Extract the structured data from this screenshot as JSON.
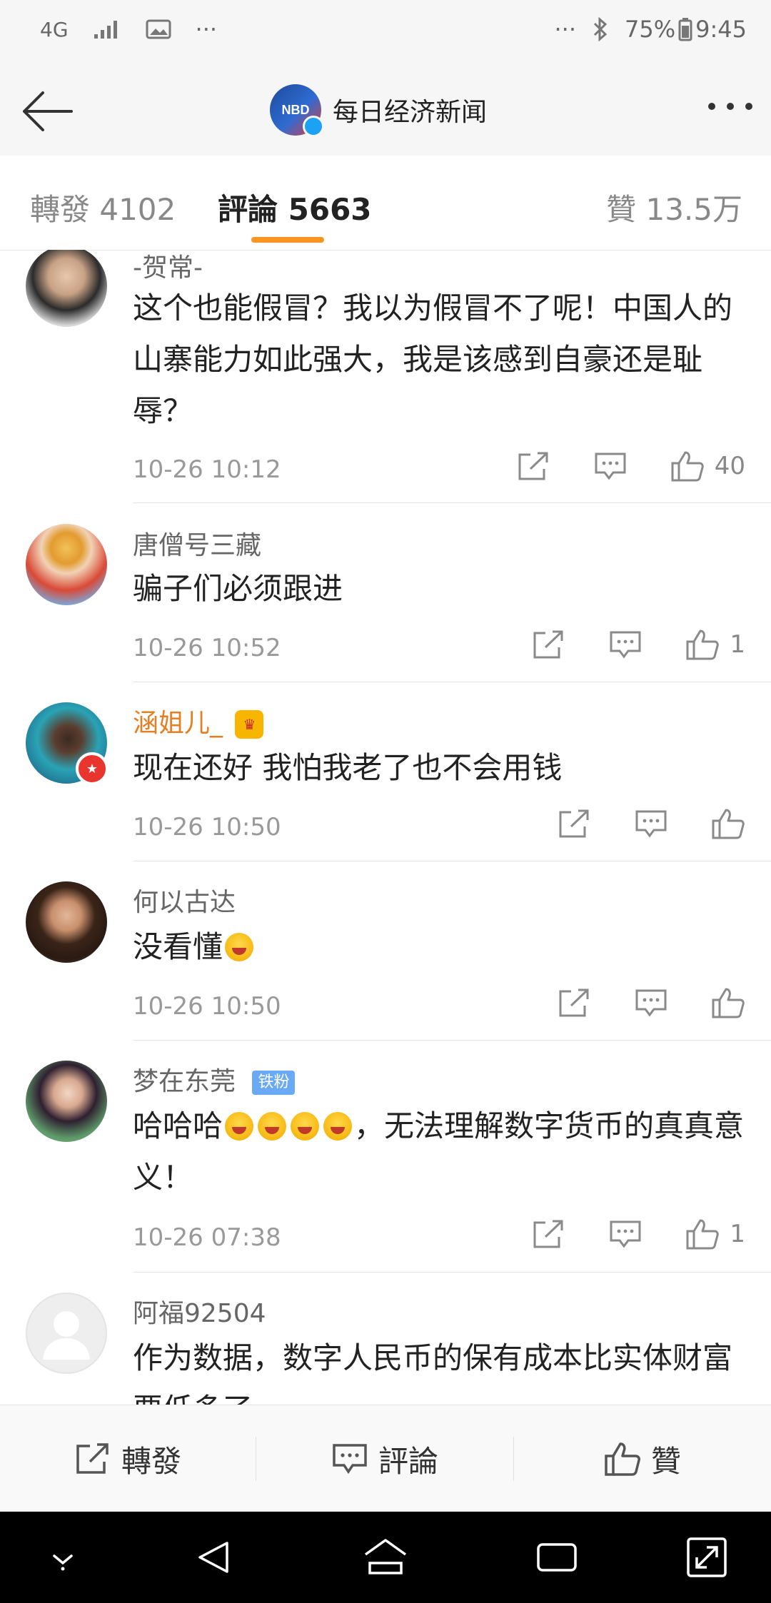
{
  "status_bar": {
    "network": "4G",
    "dots_left": "···",
    "dots_right": "···",
    "battery": "75%",
    "time": "9:45"
  },
  "header": {
    "logo_text": "NBD",
    "title": "每日经济新闻"
  },
  "tabs": [
    {
      "label": "轉發 4102"
    },
    {
      "label": "評論 5663"
    },
    {
      "label": "贊 13.5万"
    }
  ],
  "comments": [
    {
      "name": "-贺常-",
      "text": "这个也能假冒？我以为假冒不了呢！中国人的山寨能力如此强大，我是该感到自豪还是耻辱？",
      "time": "10-26 10:12",
      "likes": "40"
    },
    {
      "name": "唐僧号三藏",
      "text": "骗子们必须跟进",
      "time": "10-26 10:52",
      "likes": "1"
    },
    {
      "name": "涵姐儿_",
      "text": "现在还好 我怕我老了也不会用钱",
      "time": "10-26 10:50",
      "likes": ""
    },
    {
      "name": "何以古达",
      "text": "没看懂",
      "time": "10-26 10:50",
      "likes": ""
    },
    {
      "name": "梦在东莞",
      "badge": "铁粉",
      "text_prefix": "哈哈哈",
      "text_suffix": "，无法理解数字货币的真真意义！",
      "time": "10-26 07:38",
      "likes": "1"
    },
    {
      "name": "阿福92504",
      "text": "作为数据，数字人民币的保有成本比实体财富要低多了"
    }
  ],
  "bottom_bar": {
    "repost": "轉發",
    "comment": "評論",
    "like": "贊"
  }
}
